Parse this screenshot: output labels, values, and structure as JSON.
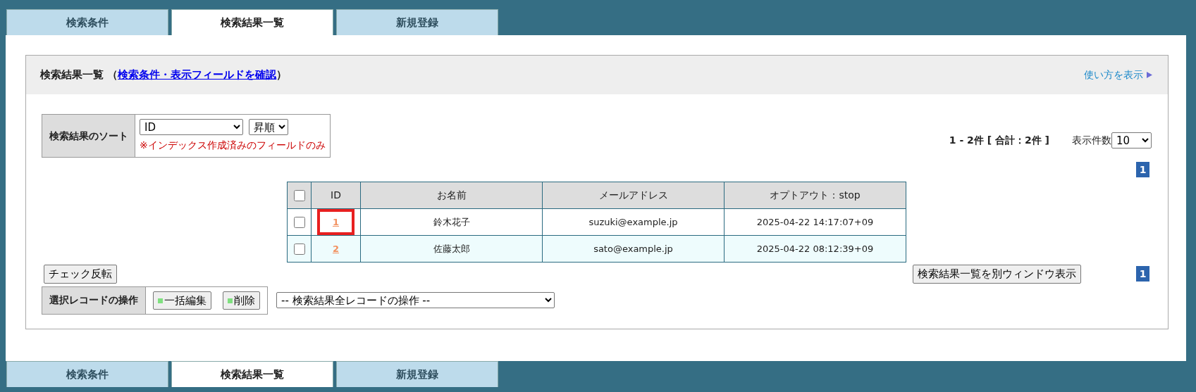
{
  "tabs_top": [
    {
      "label": "検索条件",
      "selected": false
    },
    {
      "label": "検索結果一覧",
      "selected": true
    },
    {
      "label": "新規登録",
      "selected": false
    }
  ],
  "panel": {
    "title": "検索結果一覧",
    "paren_open": "（",
    "link": "検索条件・表示フィールドを確認",
    "paren_close": "）",
    "help_link": "使い方を表示"
  },
  "sort": {
    "label": "検索結果のソート",
    "field": "ID",
    "order": "昇順",
    "note": "※インデックス作成済みのフィールドのみ"
  },
  "summary": {
    "count": "1 - 2件 [ 合計：2件 ]",
    "per_page_label": "表示件数",
    "per_page": "10"
  },
  "pager_top": [
    {
      "label": "1",
      "selected": true
    }
  ],
  "table": {
    "select_all_checked": false,
    "columns": [
      "ID",
      "お名前",
      "メールアドレス",
      "オプトアウト：stop"
    ],
    "rows": [
      {
        "checked": false,
        "highlighted": true,
        "id": "1",
        "name": "鈴木花子",
        "email": "suzuki@example.jp",
        "optout": "2025-04-22 14:17:07+09"
      },
      {
        "checked": false,
        "highlighted": false,
        "id": "2",
        "name": "佐藤太郎",
        "email": "sato@example.jp",
        "optout": "2025-04-22 08:12:39+09"
      }
    ]
  },
  "invert_button": "チェック反転",
  "popup_button": "検索結果一覧を別ウィンドウ表示",
  "pager_bottom": [
    {
      "label": "1",
      "selected": true
    }
  ],
  "selected_ops": {
    "label": "選択レコードの操作",
    "buttons": [
      "一括編集",
      "削除"
    ]
  },
  "all_ops_select": "-- 検索結果全レコードの操作 --",
  "tabs_bottom": [
    {
      "label": "検索条件",
      "selected": false
    },
    {
      "label": "検索結果一覧",
      "selected": true
    },
    {
      "label": "新規登録",
      "selected": false
    }
  ]
}
